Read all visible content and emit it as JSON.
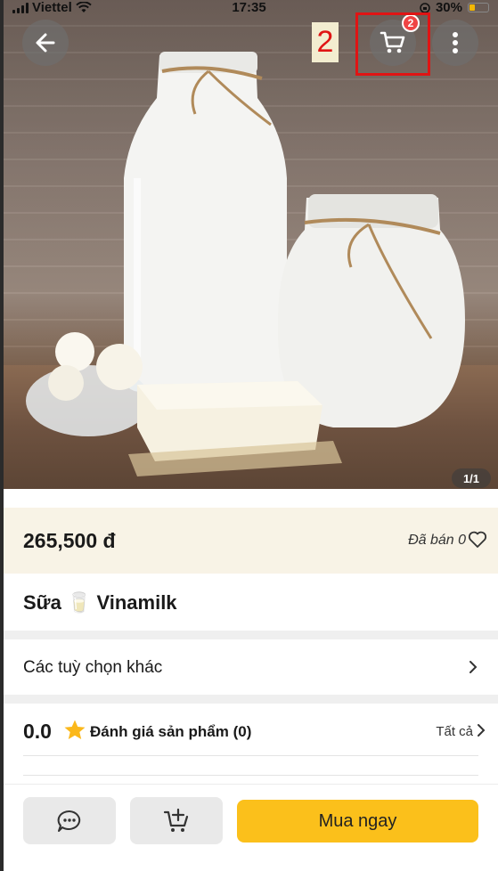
{
  "status_bar": {
    "carrier": "Viettel",
    "time": "17:35",
    "battery": "30%"
  },
  "header": {
    "back_icon": "arrow-left-icon",
    "cart_icon": "cart-icon",
    "cart_badge": "2",
    "more_icon": "more-vertical-icon",
    "annotation_label": "2"
  },
  "gallery": {
    "counter": "1/1"
  },
  "product": {
    "price": "265,500 đ",
    "sold": "Đã bán 0",
    "name": "Sữa 🥛 Vinamilk"
  },
  "options": {
    "label": "Các tuỳ chọn khác"
  },
  "rating": {
    "value": "0.0",
    "label": "Đánh giá sản phẩm (0)",
    "see_all": "Tất cả"
  },
  "bottom_bar": {
    "chat_icon": "chat-icon",
    "add_to_cart_icon": "add-to-cart-icon",
    "buy_now": "Mua ngay"
  },
  "colors": {
    "accent": "#fbc01b",
    "badge": "#ef4444",
    "annotation": "#e01414",
    "price_bg": "#f8f3e6"
  }
}
